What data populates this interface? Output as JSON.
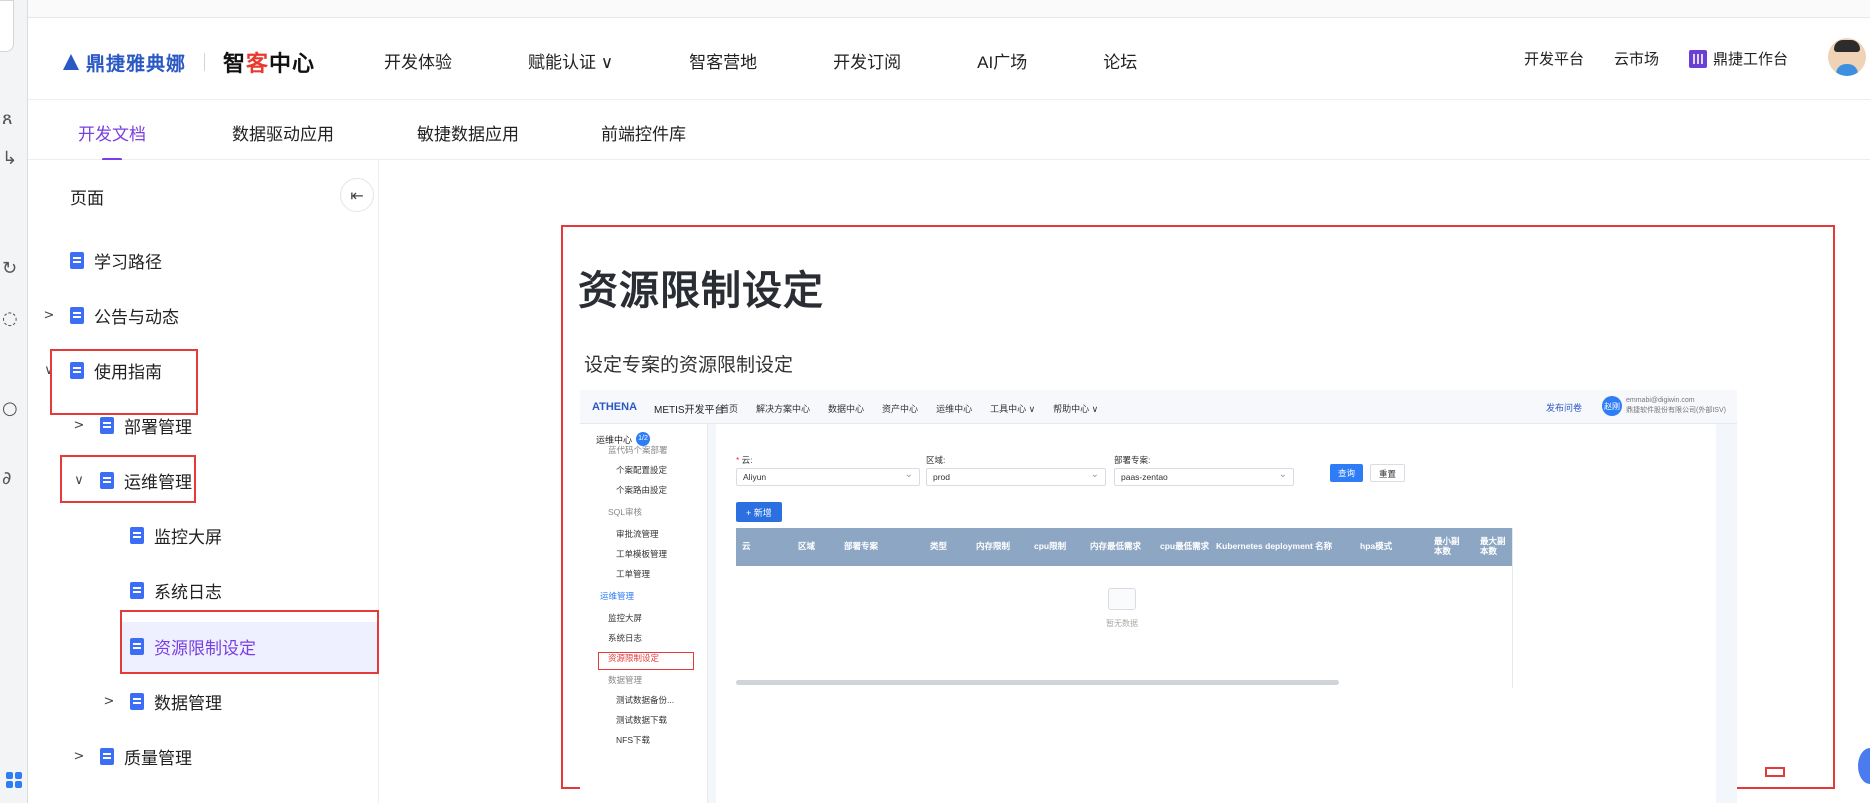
{
  "header": {
    "brand": "鼎捷雅典娜",
    "center_prefix": "智",
    "center_hi": "客",
    "center_suffix": "中心",
    "nav": [
      "开发体验",
      "赋能认证 ∨",
      "智客营地",
      "开发订阅",
      "AI广场",
      "论坛"
    ],
    "right_nav": [
      "开发平台",
      "云市场",
      "鼎捷工作台"
    ]
  },
  "subtabs": [
    "开发文档",
    "数据驱动应用",
    "敏捷数据应用",
    "前端控件库"
  ],
  "sidebar": {
    "title": "页面",
    "items": [
      {
        "label": "学习路径",
        "chev": ""
      },
      {
        "label": "公告与动态",
        "chev": ">"
      },
      {
        "label": "使用指南",
        "chev": "∨"
      },
      {
        "label": "部署管理",
        "chev": ">"
      },
      {
        "label": "运维管理",
        "chev": "∨"
      },
      {
        "label": "监控大屏",
        "chev": ""
      },
      {
        "label": "系统日志",
        "chev": ""
      },
      {
        "label": "资源限制设定",
        "chev": ""
      },
      {
        "label": "数据管理",
        "chev": ">"
      },
      {
        "label": "质量管理",
        "chev": ">"
      }
    ]
  },
  "content": {
    "title": "资源限制设定",
    "subtitle": "设定专案的资源限制设定"
  },
  "shot": {
    "title": "METIS开发平台",
    "nav": [
      "首页",
      "解决方案中心",
      "数据中心",
      "资产中心",
      "运维中心",
      "工具中心 ∨",
      "帮助中心 ∨"
    ],
    "right_link": "发布问卷",
    "avatar": "赵刚",
    "user_line1": "emmabi@digiwin.com",
    "user_line2": "鼎捷软件股份有限公司(外部ISV)",
    "side_head": "运维中心",
    "side_badge": "1/2",
    "side_items": [
      {
        "label": "蓝代码个案部署",
        "kind": "grp"
      },
      {
        "label": "个案配置設定",
        "kind": ""
      },
      {
        "label": "个案路由設定",
        "kind": ""
      },
      {
        "label": "SQL审核",
        "kind": "grp"
      },
      {
        "label": "审批流管理",
        "kind": ""
      },
      {
        "label": "工单模板管理",
        "kind": ""
      },
      {
        "label": "工单管理",
        "kind": ""
      },
      {
        "label": "运维管理",
        "kind": "grpa"
      },
      {
        "label": "监控大屏",
        "kind": ""
      },
      {
        "label": "系统日志",
        "kind": ""
      },
      {
        "label": "资源限制设定",
        "kind": "act"
      },
      {
        "label": "数据管理",
        "kind": "grp"
      },
      {
        "label": "测试数据备份...",
        "kind": ""
      },
      {
        "label": "测试数据下载",
        "kind": ""
      },
      {
        "label": "NFS下载",
        "kind": ""
      }
    ],
    "form": {
      "cloud_label": "云:",
      "cloud_value": "Aliyun",
      "region_label": "区域:",
      "region_value": "prod",
      "project_label": "部署专案:",
      "project_value": "paas-zentao",
      "query": "查询",
      "reset": "重置",
      "add": "+ 新增"
    },
    "columns": [
      "云",
      "区域",
      "部署专案",
      "类型",
      "内存限制",
      "cpu限制",
      "内存最低需求",
      "cpu最低需求",
      "Kubernetes deployment 名称",
      "hpa模式",
      "最小副本数",
      "最大副本数"
    ],
    "empty": "暂无数据"
  },
  "colors": {
    "accent": "#7a3fe0",
    "brand": "#2b59c3",
    "highlight_red": "#e53a3a",
    "doc_icon": "#3b6ef5"
  }
}
